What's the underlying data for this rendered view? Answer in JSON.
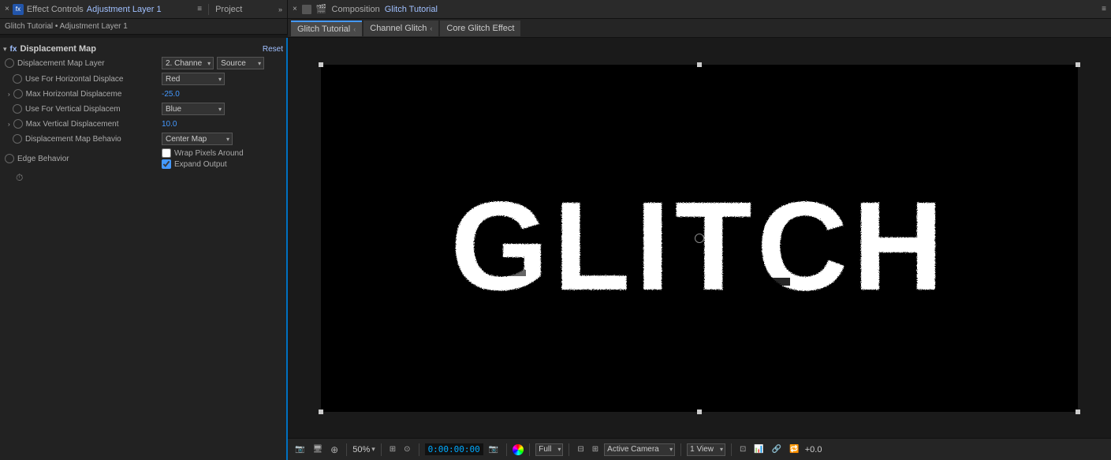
{
  "leftPanel": {
    "header": {
      "closeBtn": "×",
      "icon": "fx",
      "title": "Effect Controls",
      "titleBlue": "Adjustment Layer 1",
      "project": "Project",
      "menuIcon": "≡"
    },
    "breadcrumb": "Glitch Tutorial • Adjustment Layer 1",
    "effect": {
      "name": "Displacement Map",
      "resetLabel": "Reset",
      "properties": [
        {
          "id": "disp-map-layer",
          "label": "Displacement Map Layer",
          "hasExpand": false,
          "hasIcon": true,
          "leftDropdown": "2. Channe",
          "rightDropdown": "Source"
        },
        {
          "id": "use-horizontal",
          "label": "Use For Horizontal Displace",
          "hasIcon": true,
          "dropdown": "Red"
        },
        {
          "id": "max-horizontal",
          "label": "Max Horizontal Displaceme",
          "hasExpand": true,
          "hasIcon": true,
          "value": "-25.0"
        },
        {
          "id": "use-vertical",
          "label": "Use For Vertical Displacem",
          "hasIcon": true,
          "dropdown": "Blue"
        },
        {
          "id": "max-vertical",
          "label": "Max Vertical Displacement",
          "hasExpand": true,
          "hasIcon": true,
          "value": "10.0"
        },
        {
          "id": "disp-map-behavior",
          "label": "Displacement Map Behavio",
          "hasIcon": true,
          "dropdown": "Center Map"
        }
      ],
      "edgeBehavior": {
        "label": "Edge Behavior",
        "wrapPixels": {
          "label": "Wrap Pixels Around",
          "checked": false
        },
        "expandOutput": {
          "label": "Expand Output",
          "checked": true
        }
      }
    }
  },
  "rightPanel": {
    "tabs": [
      {
        "id": "glitch-tutorial",
        "label": "Glitch Tutorial",
        "active": true
      },
      {
        "id": "channel-glitch",
        "label": "Channel Glitch",
        "active": false
      },
      {
        "id": "core-glitch-effect",
        "label": "Core Glitch Effect",
        "active": false
      }
    ],
    "composition": {
      "icon": "🎬",
      "title": "Composition",
      "titleBlue": "Glitch Tutorial",
      "menuIcon": "≡"
    }
  },
  "canvas": {
    "glitchText": "GLITCH"
  },
  "bottomToolbar": {
    "zoomValue": "50%",
    "timecode": "0:00:00:00",
    "quality": "Full",
    "activeCamera": "Active Camera",
    "view": "1 View",
    "plusValue": "+0.0"
  }
}
